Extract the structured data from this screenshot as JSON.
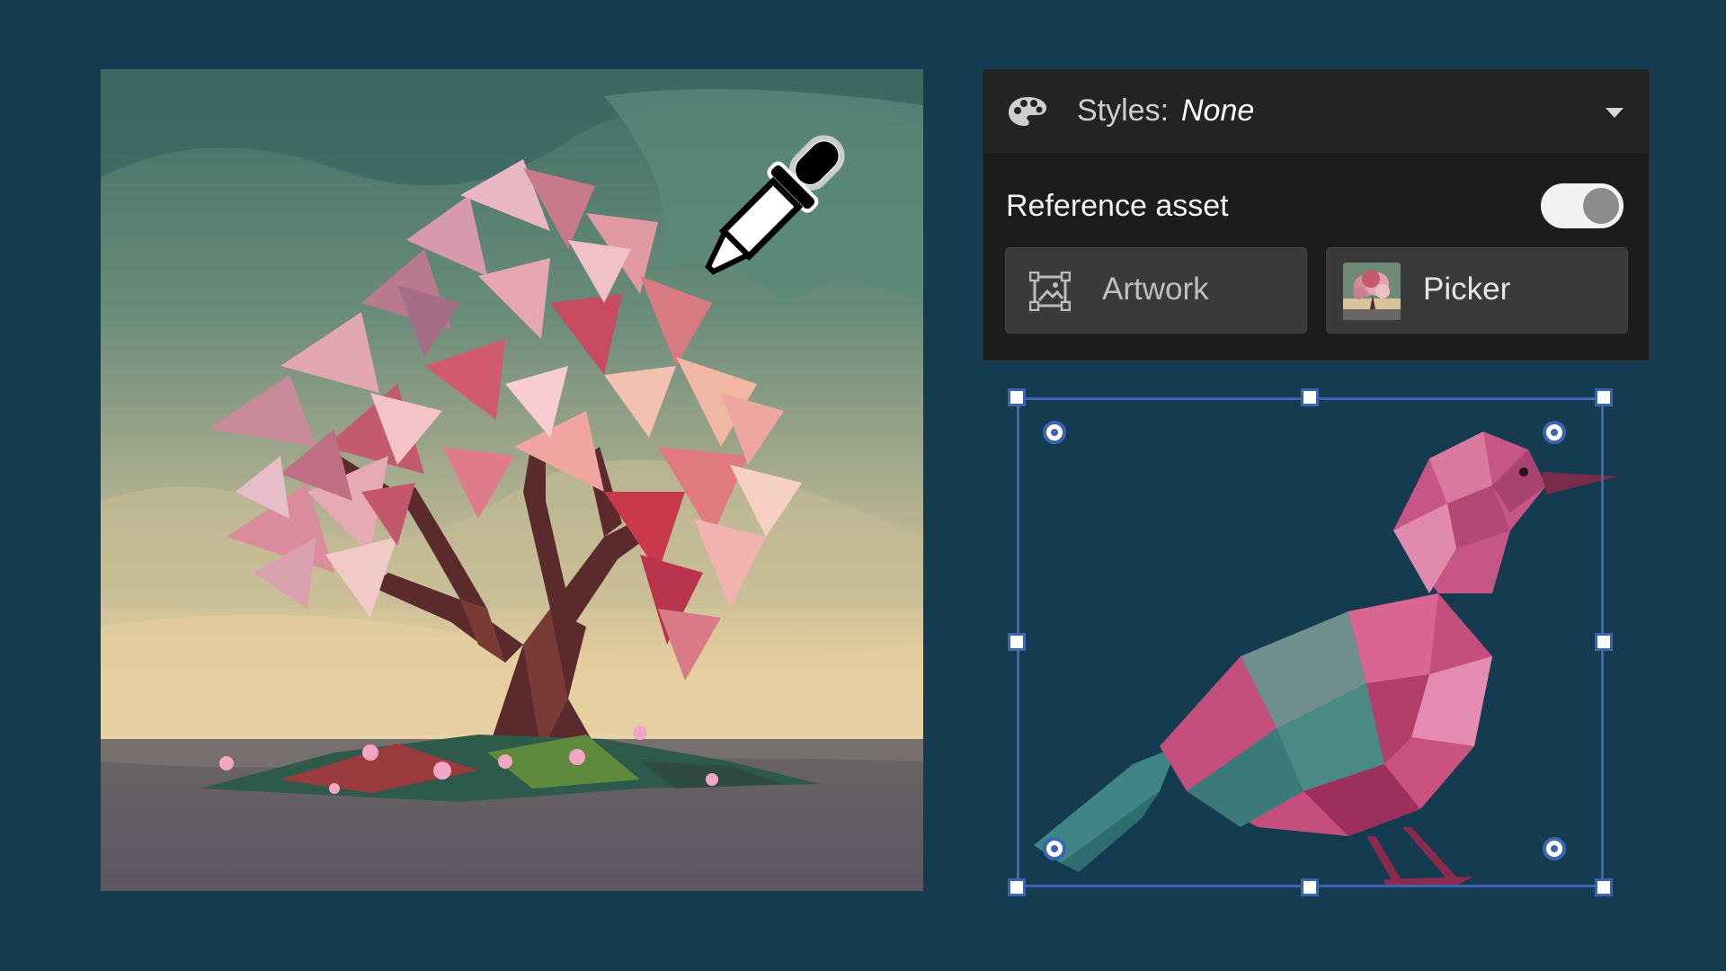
{
  "styles_panel": {
    "styles_label": "Styles:",
    "styles_value": "None",
    "reference_label": "Reference asset",
    "reference_enabled": true,
    "artwork_button_label": "Artwork",
    "picker_button_label": "Picker"
  },
  "icons": {
    "styles": "palette-icon",
    "dropdown": "chevron-down-icon",
    "artwork": "image-frame-icon",
    "picker": "tree-thumbnail",
    "cursor": "eyedropper-icon"
  },
  "colors": {
    "background": "#143b50",
    "panel": "#1c1c1c",
    "button": "#3a3a3a",
    "selection": "#3d64b0",
    "blossom": "#d9687f",
    "bird": "#c44f7d",
    "bird_teal": "#3f8585"
  }
}
